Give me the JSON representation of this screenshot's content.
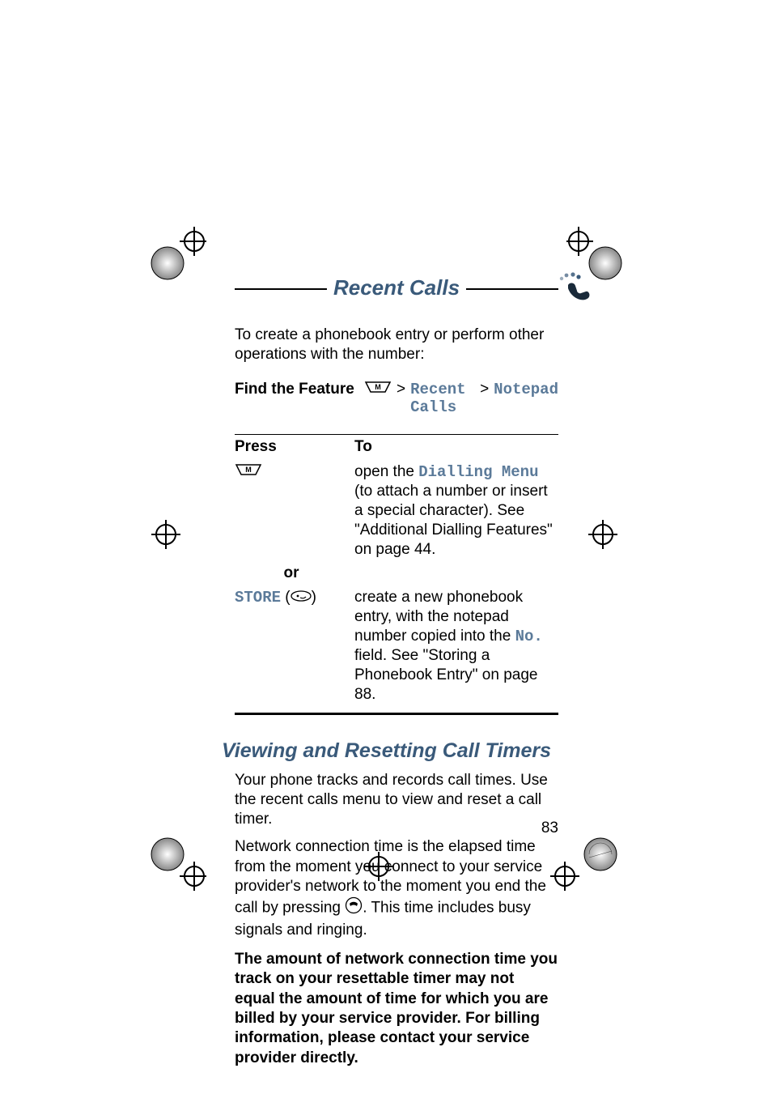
{
  "header": {
    "title": "Recent Calls"
  },
  "intro": "To create a phonebook entry or perform other operations with the number:",
  "find_the_feature": {
    "label": "Find the Feature",
    "path": [
      "Recent Calls",
      "Notepad"
    ]
  },
  "table": {
    "head_press": "Press",
    "head_to": "To",
    "rows": [
      {
        "press_type": "menu",
        "to_pre": "open the ",
        "to_mono": "Dialling Menu",
        "to_post": " (to attach a number or insert a special character). See \"Additional Dialling Features\" on page 44."
      }
    ],
    "or": "or",
    "store": {
      "label": "STORE",
      "to_pre": "create a new phonebook entry, with the notepad number copied into the ",
      "to_mono": "No.",
      "to_post": " field. See \"Storing a Phonebook Entry\" on page 88."
    }
  },
  "section": {
    "heading": "Viewing and Resetting Call Timers",
    "p1": "Your phone tracks and records call times. Use the recent calls menu to view and reset a call timer.",
    "p2_pre": "Network connection time is the elapsed time from the moment you connect to your service provider's network to the moment you end the call by pressing ",
    "p2_post": ". This time includes busy signals and ringing.",
    "bold": "The amount of network connection time you track on your resettable timer may not equal the amount of time for which you are billed by your service provider. For billing information, please contact your service provider directly."
  },
  "page_number": "83"
}
